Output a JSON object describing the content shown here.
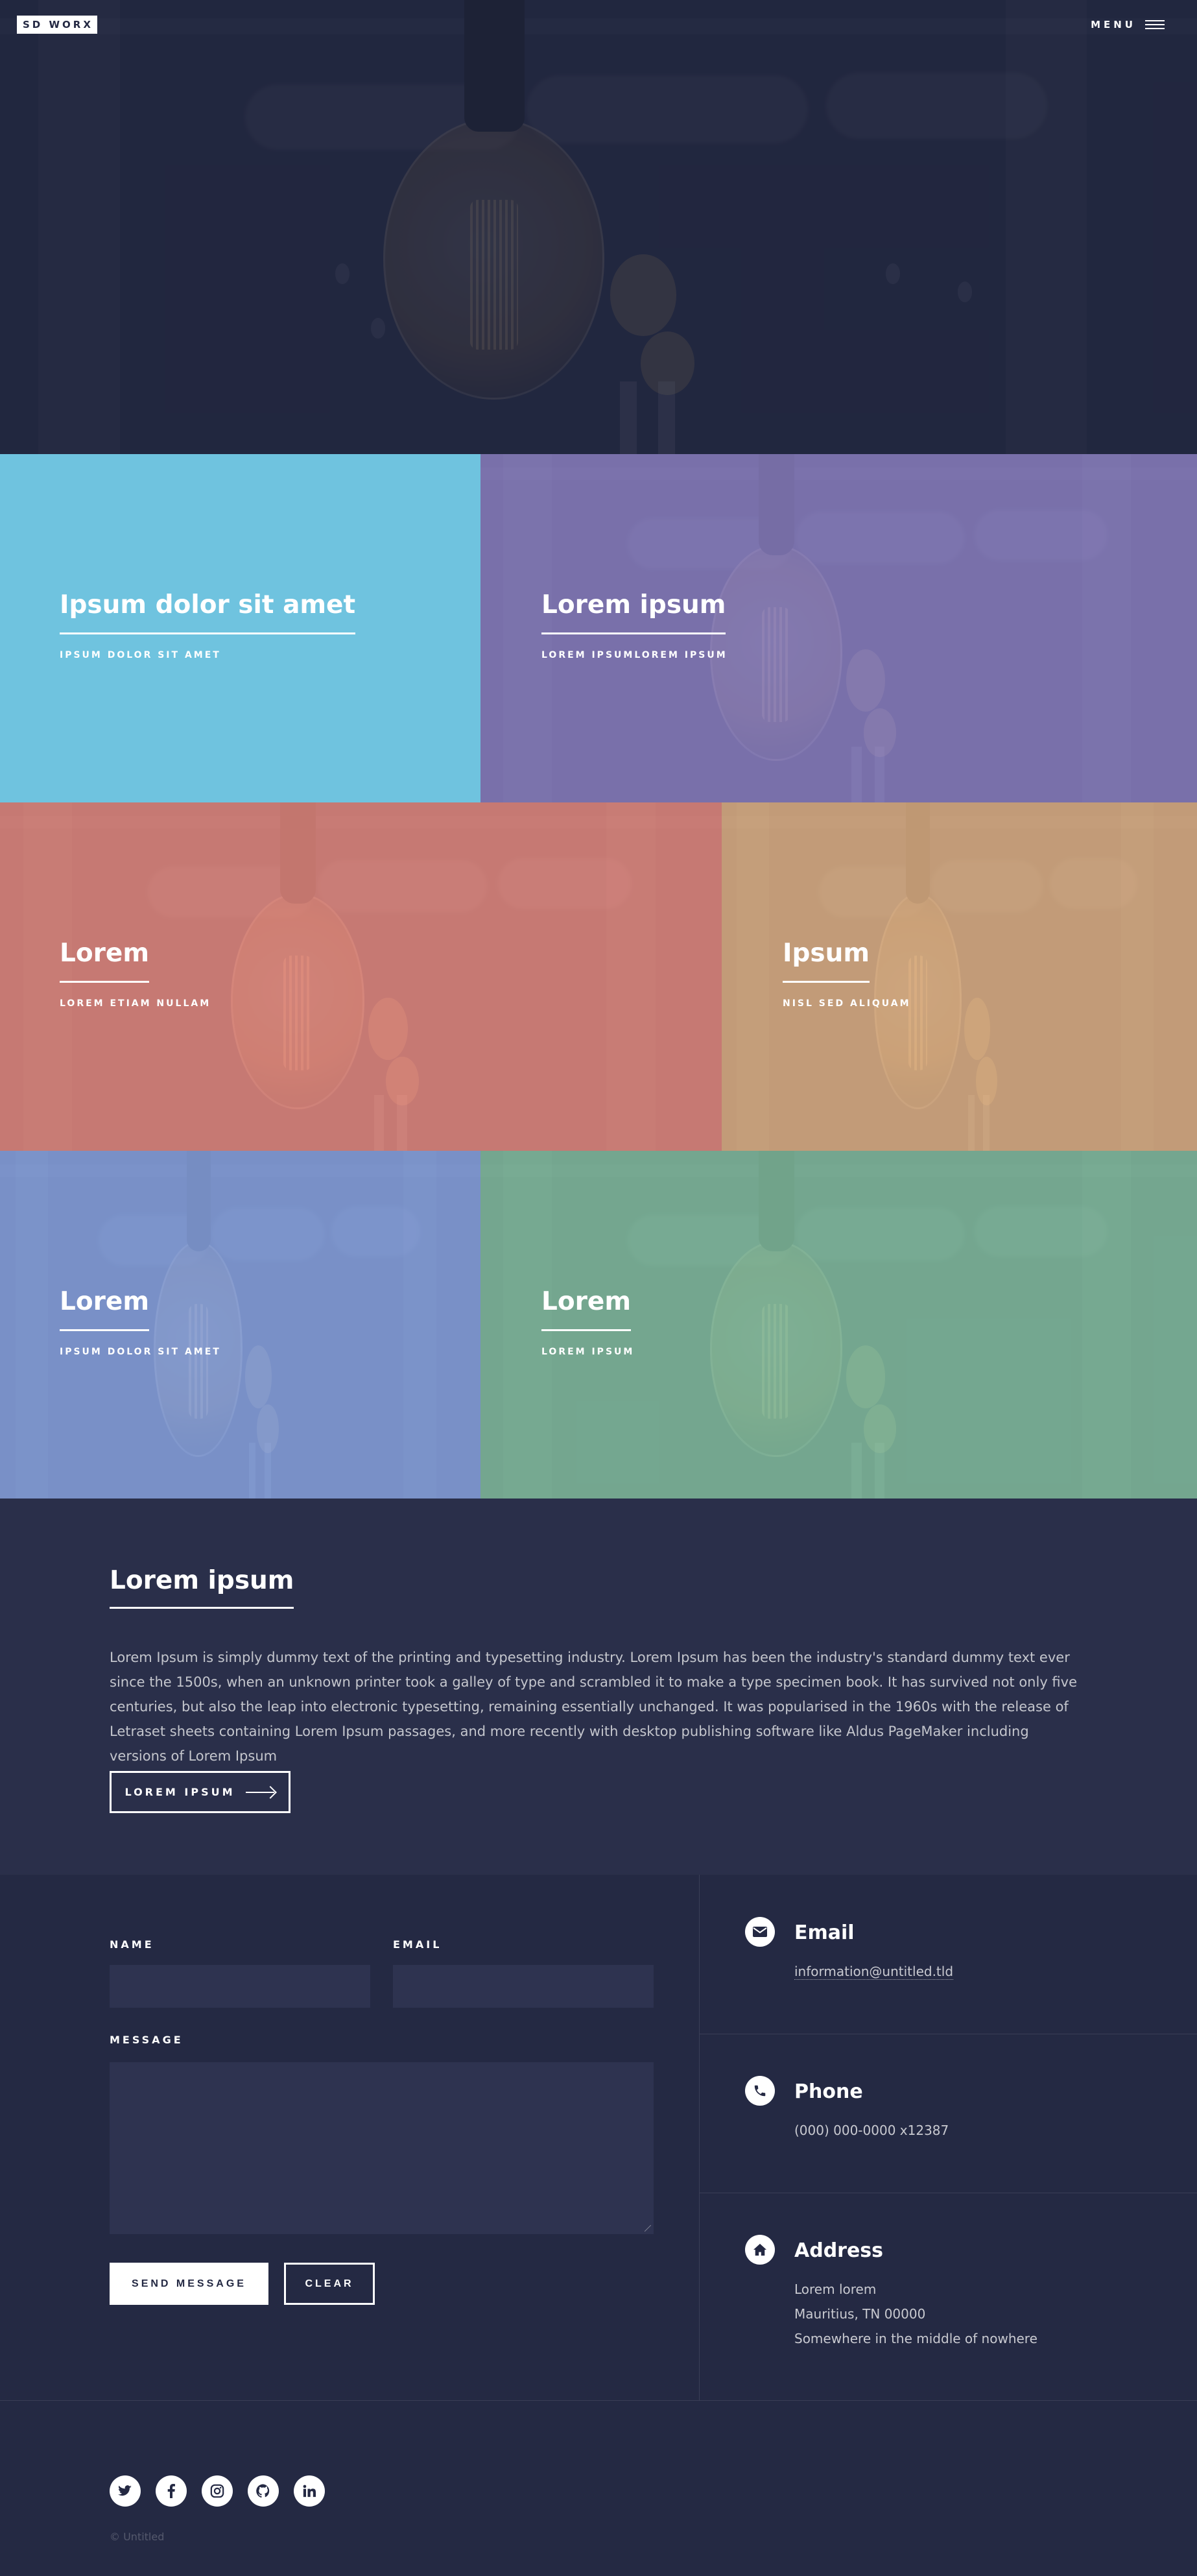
{
  "header": {
    "logo": "SD WORX",
    "menu_label": "MENU"
  },
  "tiles": [
    {
      "title": "Ipsum dolor sit amet",
      "subtitle": "IPSUM DOLOR SIT AMET",
      "color": "#6fc3df"
    },
    {
      "title": "Lorem ipsum",
      "subtitle": "LOREM IPSUMLOREM IPSUM",
      "color": "#8d82c4"
    },
    {
      "title": "Lorem",
      "subtitle": "LOREM ETIAM NULLAM",
      "color": "#ec8d81"
    },
    {
      "title": "Ipsum",
      "subtitle": "NISL SED ALIQUAM",
      "color": "#e7b788"
    },
    {
      "title": "Lorem",
      "subtitle": "IPSUM DOLOR SIT AMET",
      "color": "#8ea9e8"
    },
    {
      "title": "Lorem",
      "subtitle": "LOREM IPSUM",
      "color": "#87c5a4"
    }
  ],
  "intro": {
    "title": "Lorem ipsum",
    "body": "Lorem Ipsum is simply dummy text of the printing and typesetting industry. Lorem Ipsum has been the industry's standard dummy text ever since the 1500s, when an unknown printer took a galley of type and scrambled it to make a type specimen book. It has survived not only five centuries, but also the leap into electronic typesetting, remaining essentially unchanged. It was popularised in the 1960s with the release of Letraset sheets containing Lorem Ipsum passages, and more recently with desktop publishing software like Aldus PageMaker including versions of Lorem Ipsum",
    "button_label": "LOREM IPSUM"
  },
  "form": {
    "name_label": "NAME",
    "name_value": "",
    "email_label": "EMAIL",
    "email_value": "",
    "message_label": "MESSAGE",
    "message_value": "",
    "send_label": "SEND MESSAGE",
    "clear_label": "CLEAR"
  },
  "contact_info": {
    "email": {
      "heading": "Email",
      "value": "information@untitled.tld",
      "icon": "envelope-icon"
    },
    "phone": {
      "heading": "Phone",
      "value": "(000) 000-0000 x12387",
      "icon": "phone-icon"
    },
    "address": {
      "heading": "Address",
      "line1": "Lorem lorem",
      "line2": "Mauritius, TN 00000",
      "line3": "Somewhere in the middle of nowhere",
      "icon": "home-icon"
    }
  },
  "footer": {
    "socials": [
      "twitter-icon",
      "facebook-icon",
      "instagram-icon",
      "github-icon",
      "linkedin-icon"
    ],
    "copyright": "© Untitled"
  },
  "colors": {
    "background": "#242943",
    "intro_background": "#2a2f4a",
    "field_background": "#2e3350"
  }
}
